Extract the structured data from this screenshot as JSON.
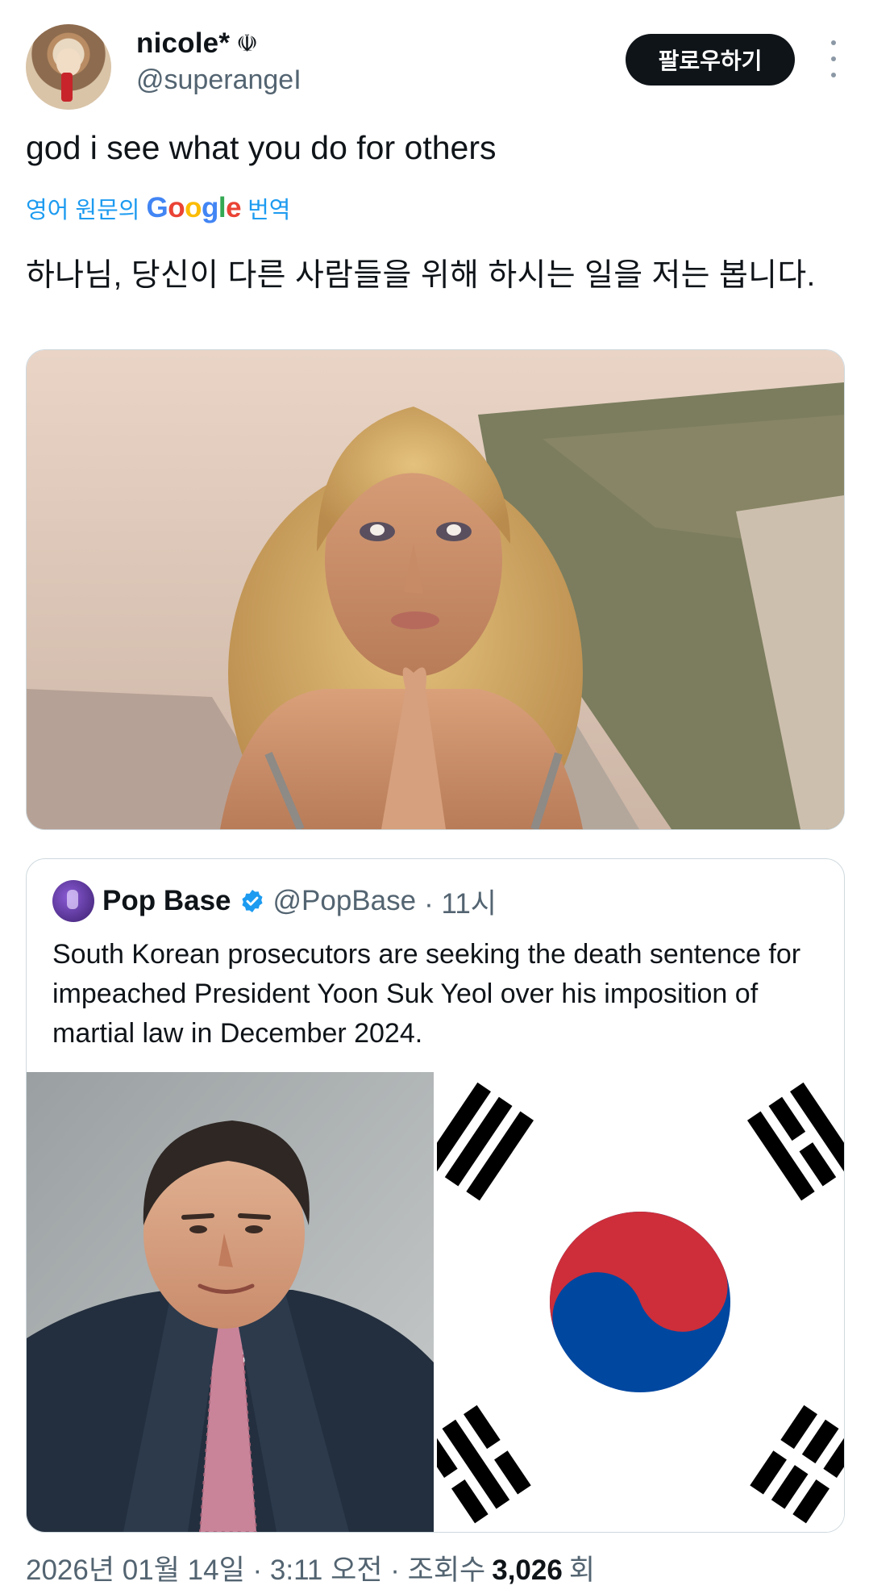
{
  "tweet": {
    "author": {
      "display_name": "nicole*",
      "name_emoji": "☫",
      "handle": "@superangeI"
    },
    "follow_label": "팔로우하기",
    "text": "god i see what you do for others",
    "translate": {
      "prefix": "영어 원문의",
      "google": [
        "G",
        "o",
        "o",
        "g",
        "l",
        "e"
      ],
      "suffix": "번역"
    },
    "translated_text": "하나님, 당신이 다른 사람들을 위해 하시는 일을 저는 봅니다."
  },
  "quote": {
    "name": "Pop Base",
    "handle": "@PopBase",
    "time": "· 11시",
    "text": "South Korean prosecutors are seeking the death sentence for impeached President Yoon Suk Yeol over his imposition of martial law in December 2024."
  },
  "meta": {
    "date": "2026년 01월 14일 · 3:11 오전 · 조회수",
    "views": "3,026",
    "views_suffix": "회"
  },
  "colors": {
    "accent": "#1d9bf0",
    "text": "#0f1419",
    "muted": "#536471",
    "flag_red": "#cd2e3a",
    "flag_blue": "#0047a0"
  }
}
